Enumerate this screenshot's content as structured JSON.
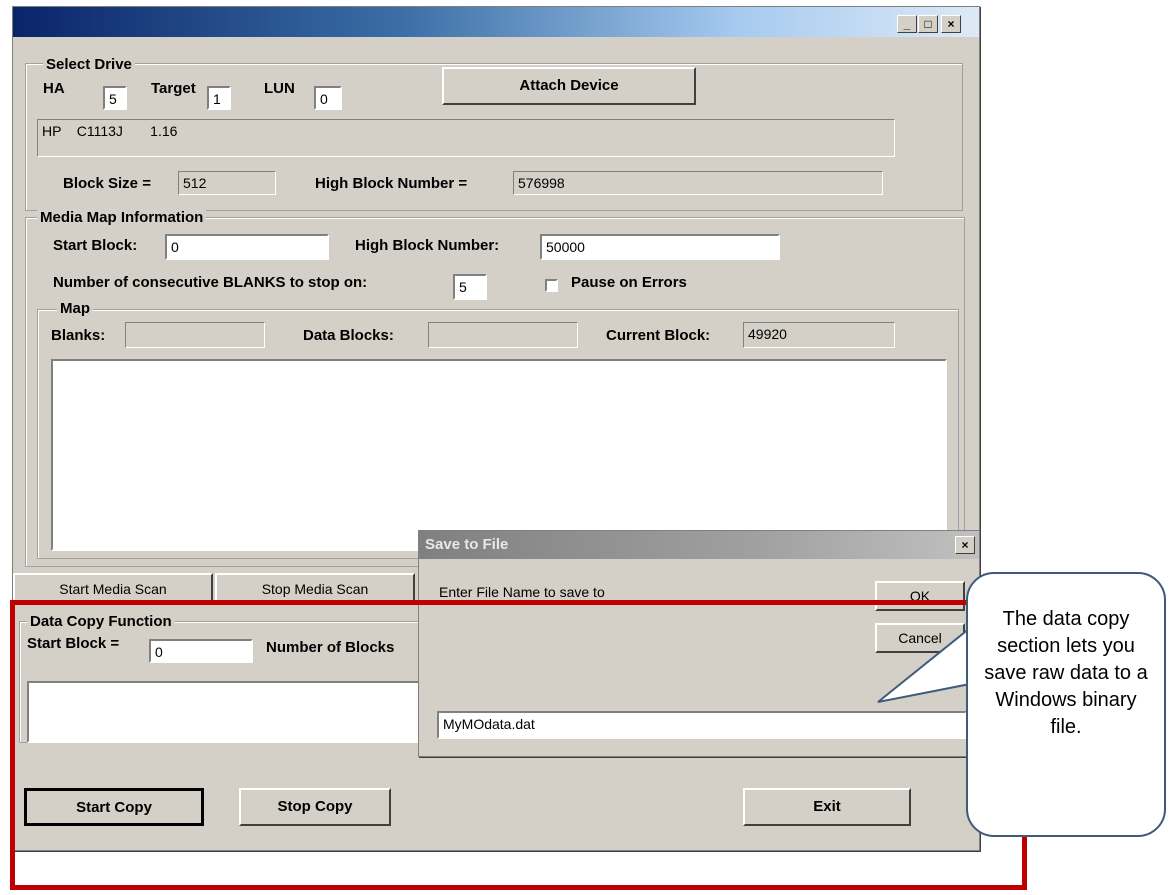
{
  "window": {
    "caption_buttons": {
      "minimize": "_",
      "maximize": "□",
      "close": "×"
    }
  },
  "select_drive": {
    "legend": "Select Drive",
    "ha_label": "HA",
    "ha_value": "5",
    "target_label": "Target",
    "target_value": "1",
    "lun_label": "LUN",
    "lun_value": "0",
    "attach_button": "Attach Device",
    "device_info": "HP    C1113J       1.16",
    "block_size_label": "Block Size =",
    "block_size_value": "512",
    "high_block_label": "High Block Number =",
    "high_block_value": "576998"
  },
  "media_map": {
    "legend": "Media Map Information",
    "start_block_label": "Start Block:",
    "start_block_value": "0",
    "high_block_label": "High Block Number:",
    "high_block_value": "50000",
    "blanks_stop_label": "Number of consecutive BLANKS to stop on:",
    "blanks_stop_value": "5",
    "pause_label": "Pause on Errors",
    "map": {
      "legend": "Map",
      "blanks_label": "Blanks:",
      "blanks_value": "",
      "data_blocks_label": "Data Blocks:",
      "data_blocks_value": "",
      "current_block_label": "Current Block:",
      "current_block_value": "49920"
    }
  },
  "scan_buttons": {
    "start": "Start Media Scan",
    "stop": "Stop Media Scan"
  },
  "data_copy": {
    "legend": "Data Copy Function",
    "start_block_label": "Start Block =",
    "start_block_value": "0",
    "num_blocks_label": "Number of Blocks",
    "start_copy": "Start Copy",
    "stop_copy": "Stop Copy",
    "exit": "Exit"
  },
  "dialog": {
    "title": "Save to File",
    "close": "×",
    "prompt": "Enter File Name to save to",
    "ok": "OK",
    "cancel": "Cancel",
    "filename": "MyMOdata.dat"
  },
  "callout": {
    "text": "The data copy section lets you save raw data to a Windows binary file."
  },
  "colors": {
    "highlight_border": "#c00000",
    "titlebar_active": "#0a246a",
    "face": "#d4d0c8"
  }
}
